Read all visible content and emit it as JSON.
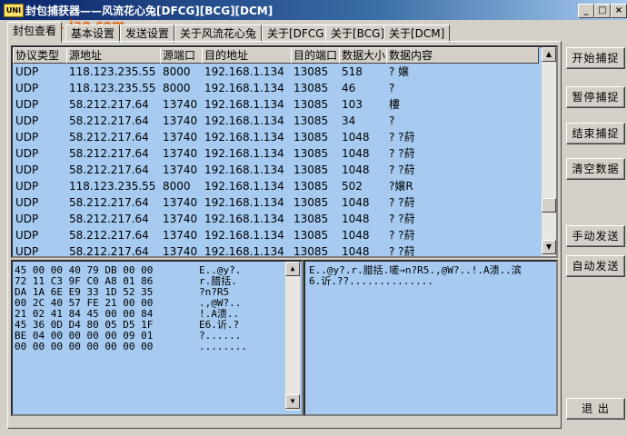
{
  "window": {
    "title": "封包捕获器——风流花心兔[DFCG][BCG][DCM]",
    "icon_label": "UNI"
  },
  "watermark": "...iao.com",
  "tabs": [
    {
      "label": "封包查看",
      "active": true
    },
    {
      "label": "基本设置",
      "active": false
    },
    {
      "label": "发送设置",
      "active": false
    },
    {
      "label": "关于风流花心兔",
      "active": false
    },
    {
      "label": "关于[DFCG]",
      "active": false
    },
    {
      "label": "关于[BCG]",
      "active": false
    },
    {
      "label": "关于[DCM]",
      "active": false
    }
  ],
  "packet_table": {
    "columns": [
      "协议类型",
      "源地址",
      "源端口",
      "目的地址",
      "目的端口",
      "数据大小",
      "数据内容"
    ],
    "rows": [
      [
        "UDP",
        "118.123.235.55",
        "8000",
        "192.168.1.134",
        "13085",
        "518",
        "?  嬢"
      ],
      [
        "UDP",
        "118.123.235.55",
        "8000",
        "192.168.1.134",
        "13085",
        "46",
        "?"
      ],
      [
        "UDP",
        "58.212.217.64",
        "13740",
        "192.168.1.134",
        "13085",
        "103",
        "樓"
      ],
      [
        "UDP",
        "58.212.217.64",
        "13740",
        "192.168.1.134",
        "13085",
        "34",
        "?"
      ],
      [
        "UDP",
        "58.212.217.64",
        "13740",
        "192.168.1.134",
        "13085",
        "1048",
        "? ?葤"
      ],
      [
        "UDP",
        "58.212.217.64",
        "13740",
        "192.168.1.134",
        "13085",
        "1048",
        "? ?葤"
      ],
      [
        "UDP",
        "58.212.217.64",
        "13740",
        "192.168.1.134",
        "13085",
        "1048",
        "? ?葤"
      ],
      [
        "UDP",
        "118.123.235.55",
        "8000",
        "192.168.1.134",
        "13085",
        "502",
        "  ?嬢R"
      ],
      [
        "UDP",
        "58.212.217.64",
        "13740",
        "192.168.1.134",
        "13085",
        "1048",
        "? ?葤"
      ],
      [
        "UDP",
        "58.212.217.64",
        "13740",
        "192.168.1.134",
        "13085",
        "1048",
        "? ?葤"
      ],
      [
        "UDP",
        "58.212.217.64",
        "13740",
        "192.168.1.134",
        "13085",
        "1048",
        "? ?葤"
      ],
      [
        "UDP",
        "58.212.217.64",
        "13740",
        "192.168.1.134",
        "13085",
        "1048",
        "? ?葤"
      ]
    ]
  },
  "hex_dump": {
    "hex": [
      "45 00 00 40 79 DB 00 00",
      "72 11 C3 9F C0 A8 01 86",
      "DA 1A 6E E9 33 1D 52 35",
      "00 2C 40 57 FE 21 00 00",
      "21 02 41 84 45 00 00 84",
      "45 36 0D D4 80 05 D5 1F",
      "BE 04 00 00 00 00 09 01",
      "00 00 00 00 00 00 00 00"
    ],
    "ascii": [
      "E..@y?.",
      "r.腊括.",
      "?n?R5",
      ".,@W?..",
      "!.A溃..",
      "E6.䜣.?",
      "?......",
      "........"
    ]
  },
  "text_view": {
    "lines": [
      "E..@y?.r.腊括.嗟→n?R5.,@W?..!.A溃..滨",
      "6.䜣.??.............."
    ]
  },
  "buttons": {
    "start_capture": "开始捕捉",
    "pause_capture": "暂停捕捉",
    "stop_capture": "结束捕捉",
    "clear_data": "清空数据",
    "manual_send": "手动发送",
    "auto_send": "自动发送",
    "exit": "退 出"
  }
}
